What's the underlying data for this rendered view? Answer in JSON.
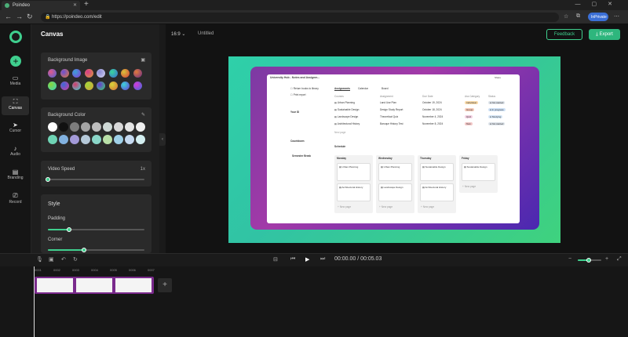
{
  "browser": {
    "tab_title": "Poindeo",
    "url": "https://poindeo.com/edit",
    "profile_label": "InPrivate"
  },
  "nav": {
    "items": [
      {
        "label": "Media",
        "icon": "folder-icon"
      },
      {
        "label": "Canvas",
        "icon": "canvas-icon"
      },
      {
        "label": "Cursor",
        "icon": "cursor-icon"
      },
      {
        "label": "Audio",
        "icon": "audio-icon"
      },
      {
        "label": "Branding",
        "icon": "branding-icon"
      },
      {
        "label": "Record",
        "icon": "record-icon"
      }
    ],
    "active": "Canvas"
  },
  "panel": {
    "title": "Canvas",
    "background_image_title": "Background Image",
    "background_color_title": "Background Color",
    "video_speed_label": "Video Speed",
    "video_speed_value": "1x",
    "video_speed_fraction": 0.0,
    "style_title": "Style",
    "padding_label": "Padding",
    "padding_fraction": 0.22,
    "corner_label": "Corner",
    "corner_fraction": 0.37,
    "colors": [
      "#ffffff",
      "#111111",
      "#7d7d7d",
      "#a5a5a5",
      "#bdbdbd",
      "#cfd9d6",
      "#d8d8d8",
      "#e5e5e5",
      "#f0f0f0",
      "#6fd4b5",
      "#82b2e0",
      "#a39ad8",
      "#b5c8d8",
      "#8ad6c8",
      "#b9e0a8",
      "#9fd0e8",
      "#c5d9f0",
      "#d3eef0"
    ]
  },
  "topbar": {
    "ratio": "16:9",
    "project_name": "Untitled",
    "feedback_label": "Feedback",
    "export_label": "Export"
  },
  "screen": {
    "title": "University Hub - Notes and Assignm...",
    "share": "Share",
    "tabs": [
      "Assignments",
      "Calendar",
      "Board"
    ],
    "headers": [
      "Courses",
      "Assignment",
      "Due Date",
      "Ass Category",
      "Status"
    ],
    "rows": [
      {
        "course": "Urban Planning",
        "assignment": "Land Use Plan",
        "due": "October 19, 2024",
        "category": "Individual",
        "status": "Not started"
      },
      {
        "course": "Sustainable Design",
        "assignment": "Design Study Report",
        "due": "October 18, 2024",
        "category": "Group",
        "status": "In progress"
      },
      {
        "course": "Landscape Design",
        "assignment": "Theoretical Quiz",
        "due": "November 4, 2024",
        "category": "Quiz",
        "status": "Studying"
      },
      {
        "course": "Architectural History",
        "assignment": "Baroque History Test",
        "due": "November 8, 2024",
        "category": "Test",
        "status": "Not started"
      }
    ],
    "new_page": "New page",
    "schedule_title": "Schedule",
    "sidebar_items": [
      "Return books to library",
      "Print report"
    ],
    "your_id": "Your ID",
    "countdown": "Countdown",
    "semester_break": "Semester Break",
    "columns": [
      {
        "day": "Monday",
        "cards": [
          "Urban Planning",
          "Architectural History"
        ]
      },
      {
        "day": "Wednesday",
        "cards": [
          "Urban Planning",
          "Landscape Design"
        ]
      },
      {
        "day": "Thursday",
        "cards": [
          "Sustainable Design",
          "Architectural History"
        ]
      },
      {
        "day": "Friday",
        "cards": [
          "Sustainable Design"
        ]
      }
    ]
  },
  "timeline": {
    "timecode": "00:00.00 / 00:05.03",
    "ruler": [
      "0001",
      "0002",
      "0003",
      "0004",
      "0005",
      "0006",
      "0007"
    ]
  }
}
